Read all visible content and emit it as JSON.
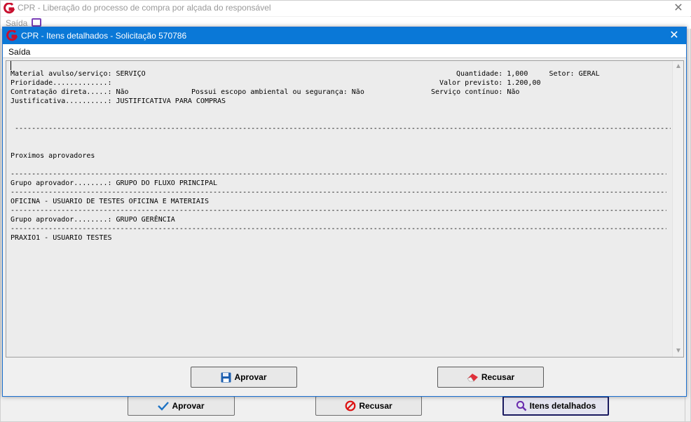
{
  "background_window": {
    "title": "CPR - Liberação do processo de compra por alçada do responsável",
    "menu_item": "Saída",
    "buttons": {
      "aprovar": "Aprovar",
      "recusar": "Recusar",
      "itens_detalhados": "Itens detalhados"
    }
  },
  "dialog": {
    "title": "CPR - Itens detalhados - Solicitação 570786",
    "menu_item": "Saída",
    "buttons": {
      "aprovar": "Aprovar",
      "recusar": "Recusar"
    }
  },
  "report": {
    "row1_left": "Material avulso/serviço: SERVIÇO",
    "row1_right": "Quantidade: 1,000     Setor: GERAL",
    "row2_left": "Prioridade.............:",
    "row2_right": "Valor previsto: 1.200,00",
    "row3_left": "Contratação direta.....: Não",
    "row3_mid": "Possui escopo ambiental ou segurança: Não",
    "row3_right": "Serviço contínuo: Não",
    "row4_left": "Justificativa..........: JUSTIFICATIVA PARA COMPRAS",
    "section_title": "Proximos aprovadores",
    "group1": "Grupo aprovador........: GRUPO DO FLUXO PRINCIPAL",
    "user1": "OFICINA - USUARIO DE TESTES OFICINA E MATERIAIS",
    "group2": "Grupo aprovador........: GRUPO GERÊNCIA",
    "user2": "PRAXIO1 - USUARIO TESTES"
  },
  "colors": {
    "titlebar": "#0a78d7",
    "logo_red": "#c8102e",
    "background": "#f0f0f0"
  },
  "icons": {
    "aprovar_bg": "checkmark-icon",
    "recusar_bg": "prohibited-icon",
    "itens": "magnifier-icon",
    "aprovar_dlg": "floppy-disk-icon",
    "recusar_dlg": "eraser-icon"
  }
}
